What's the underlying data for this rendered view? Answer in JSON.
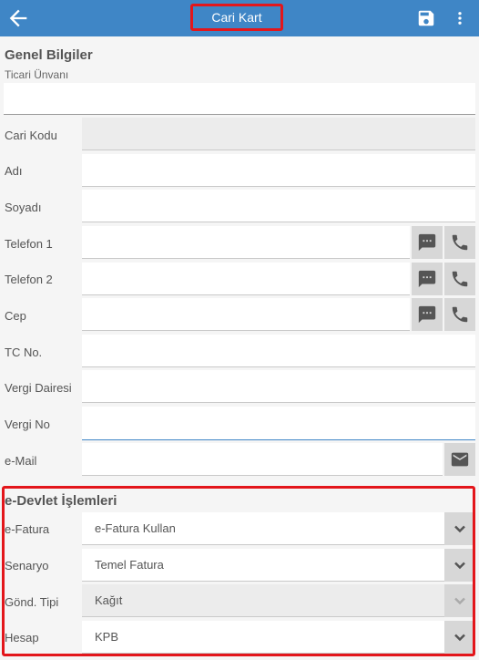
{
  "appbar": {
    "title": "Cari Kart",
    "bg": "#3f86c6",
    "icons": [
      "back-arrow-icon",
      "save-icon",
      "more-vert-icon"
    ]
  },
  "general": {
    "title": "Genel Bilgiler",
    "trade_name_label": "Ticari Ünvanı",
    "fields": [
      {
        "label": "Cari Kodu"
      },
      {
        "label": "Adı"
      },
      {
        "label": "Soyadı"
      },
      {
        "label": "Telefon 1"
      },
      {
        "label": "Telefon 2"
      },
      {
        "label": "Cep"
      },
      {
        "label": "TC No."
      },
      {
        "label": "Vergi Dairesi"
      },
      {
        "label": "Vergi No"
      },
      {
        "label": "e-Mail"
      }
    ]
  },
  "edevlet": {
    "title": "e-Devlet İşlemleri",
    "fields": [
      {
        "label": "e-Fatura",
        "value": "e-Fatura Kullan"
      },
      {
        "label": "Senaryo",
        "value": "Temel Fatura"
      },
      {
        "label": "Gönd. Tipi",
        "value": "Kağıt"
      },
      {
        "label": "Hesap",
        "value": "KPB"
      }
    ]
  },
  "colors": {
    "accent": "#3f86c6",
    "highlight": "#e3161b",
    "button_bg": "#d7d7d7"
  }
}
